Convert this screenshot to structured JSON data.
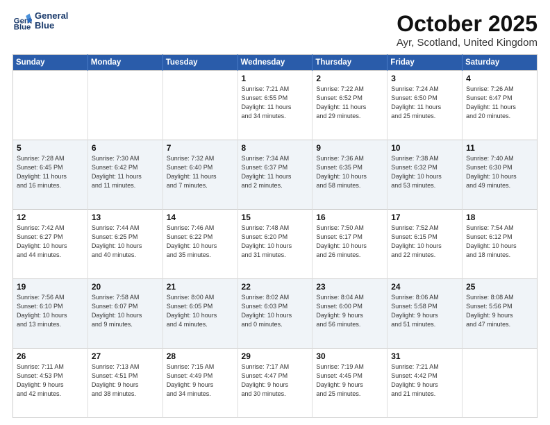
{
  "logo": {
    "line1": "General",
    "line2": "Blue"
  },
  "title": "October 2025",
  "subtitle": "Ayr, Scotland, United Kingdom",
  "days_of_week": [
    "Sunday",
    "Monday",
    "Tuesday",
    "Wednesday",
    "Thursday",
    "Friday",
    "Saturday"
  ],
  "weeks": [
    [
      {
        "num": "",
        "detail": ""
      },
      {
        "num": "",
        "detail": ""
      },
      {
        "num": "",
        "detail": ""
      },
      {
        "num": "1",
        "detail": "Sunrise: 7:21 AM\nSunset: 6:55 PM\nDaylight: 11 hours\nand 34 minutes."
      },
      {
        "num": "2",
        "detail": "Sunrise: 7:22 AM\nSunset: 6:52 PM\nDaylight: 11 hours\nand 29 minutes."
      },
      {
        "num": "3",
        "detail": "Sunrise: 7:24 AM\nSunset: 6:50 PM\nDaylight: 11 hours\nand 25 minutes."
      },
      {
        "num": "4",
        "detail": "Sunrise: 7:26 AM\nSunset: 6:47 PM\nDaylight: 11 hours\nand 20 minutes."
      }
    ],
    [
      {
        "num": "5",
        "detail": "Sunrise: 7:28 AM\nSunset: 6:45 PM\nDaylight: 11 hours\nand 16 minutes."
      },
      {
        "num": "6",
        "detail": "Sunrise: 7:30 AM\nSunset: 6:42 PM\nDaylight: 11 hours\nand 11 minutes."
      },
      {
        "num": "7",
        "detail": "Sunrise: 7:32 AM\nSunset: 6:40 PM\nDaylight: 11 hours\nand 7 minutes."
      },
      {
        "num": "8",
        "detail": "Sunrise: 7:34 AM\nSunset: 6:37 PM\nDaylight: 11 hours\nand 2 minutes."
      },
      {
        "num": "9",
        "detail": "Sunrise: 7:36 AM\nSunset: 6:35 PM\nDaylight: 10 hours\nand 58 minutes."
      },
      {
        "num": "10",
        "detail": "Sunrise: 7:38 AM\nSunset: 6:32 PM\nDaylight: 10 hours\nand 53 minutes."
      },
      {
        "num": "11",
        "detail": "Sunrise: 7:40 AM\nSunset: 6:30 PM\nDaylight: 10 hours\nand 49 minutes."
      }
    ],
    [
      {
        "num": "12",
        "detail": "Sunrise: 7:42 AM\nSunset: 6:27 PM\nDaylight: 10 hours\nand 44 minutes."
      },
      {
        "num": "13",
        "detail": "Sunrise: 7:44 AM\nSunset: 6:25 PM\nDaylight: 10 hours\nand 40 minutes."
      },
      {
        "num": "14",
        "detail": "Sunrise: 7:46 AM\nSunset: 6:22 PM\nDaylight: 10 hours\nand 35 minutes."
      },
      {
        "num": "15",
        "detail": "Sunrise: 7:48 AM\nSunset: 6:20 PM\nDaylight: 10 hours\nand 31 minutes."
      },
      {
        "num": "16",
        "detail": "Sunrise: 7:50 AM\nSunset: 6:17 PM\nDaylight: 10 hours\nand 26 minutes."
      },
      {
        "num": "17",
        "detail": "Sunrise: 7:52 AM\nSunset: 6:15 PM\nDaylight: 10 hours\nand 22 minutes."
      },
      {
        "num": "18",
        "detail": "Sunrise: 7:54 AM\nSunset: 6:12 PM\nDaylight: 10 hours\nand 18 minutes."
      }
    ],
    [
      {
        "num": "19",
        "detail": "Sunrise: 7:56 AM\nSunset: 6:10 PM\nDaylight: 10 hours\nand 13 minutes."
      },
      {
        "num": "20",
        "detail": "Sunrise: 7:58 AM\nSunset: 6:07 PM\nDaylight: 10 hours\nand 9 minutes."
      },
      {
        "num": "21",
        "detail": "Sunrise: 8:00 AM\nSunset: 6:05 PM\nDaylight: 10 hours\nand 4 minutes."
      },
      {
        "num": "22",
        "detail": "Sunrise: 8:02 AM\nSunset: 6:03 PM\nDaylight: 10 hours\nand 0 minutes."
      },
      {
        "num": "23",
        "detail": "Sunrise: 8:04 AM\nSunset: 6:00 PM\nDaylight: 9 hours\nand 56 minutes."
      },
      {
        "num": "24",
        "detail": "Sunrise: 8:06 AM\nSunset: 5:58 PM\nDaylight: 9 hours\nand 51 minutes."
      },
      {
        "num": "25",
        "detail": "Sunrise: 8:08 AM\nSunset: 5:56 PM\nDaylight: 9 hours\nand 47 minutes."
      }
    ],
    [
      {
        "num": "26",
        "detail": "Sunrise: 7:11 AM\nSunset: 4:53 PM\nDaylight: 9 hours\nand 42 minutes."
      },
      {
        "num": "27",
        "detail": "Sunrise: 7:13 AM\nSunset: 4:51 PM\nDaylight: 9 hours\nand 38 minutes."
      },
      {
        "num": "28",
        "detail": "Sunrise: 7:15 AM\nSunset: 4:49 PM\nDaylight: 9 hours\nand 34 minutes."
      },
      {
        "num": "29",
        "detail": "Sunrise: 7:17 AM\nSunset: 4:47 PM\nDaylight: 9 hours\nand 30 minutes."
      },
      {
        "num": "30",
        "detail": "Sunrise: 7:19 AM\nSunset: 4:45 PM\nDaylight: 9 hours\nand 25 minutes."
      },
      {
        "num": "31",
        "detail": "Sunrise: 7:21 AM\nSunset: 4:42 PM\nDaylight: 9 hours\nand 21 minutes."
      },
      {
        "num": "",
        "detail": ""
      }
    ]
  ]
}
